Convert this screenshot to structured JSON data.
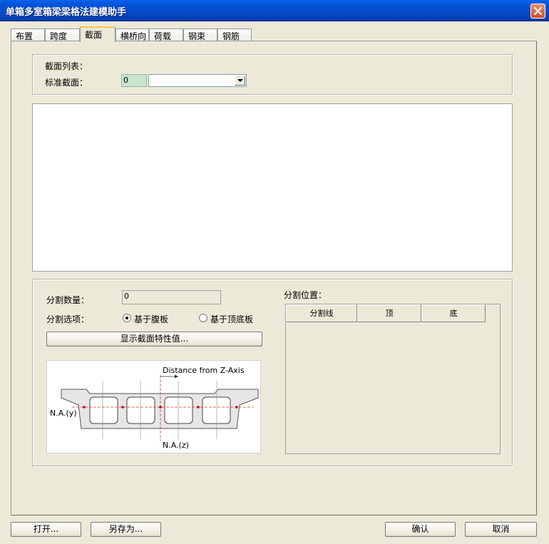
{
  "window": {
    "title": "单箱多室箱梁梁格法建模助手"
  },
  "tabs": [
    {
      "label": "布置"
    },
    {
      "label": "跨度"
    },
    {
      "label": "截面"
    },
    {
      "label": "横桥向"
    },
    {
      "label": "荷载"
    },
    {
      "label": "钢束"
    },
    {
      "label": "钢筋"
    }
  ],
  "active_tab": "截面",
  "section_list": {
    "label": "截面列表：",
    "standard_label": "标准截面：",
    "standard_number": "0",
    "standard_value": ""
  },
  "division": {
    "count_label": "分割数量：",
    "count_value": "0",
    "option_label": "分割选项：",
    "option_web": "基于腹板",
    "option_flange": "基于顶底板",
    "selected_option": "基于腹板",
    "show_props_button": "显示截面特性值...",
    "positions_label": "分割位置：",
    "columns": [
      "分割线",
      "顶",
      "底"
    ]
  },
  "diagram": {
    "distance_label": "Distance from Z-Axis",
    "na_y_label": "N.A.(y)",
    "na_z_label": "N.A.(z)"
  },
  "footer": {
    "open_button": "打开...",
    "save_as_button": "另存为...",
    "ok_button": "确认",
    "cancel_button": "取消"
  }
}
